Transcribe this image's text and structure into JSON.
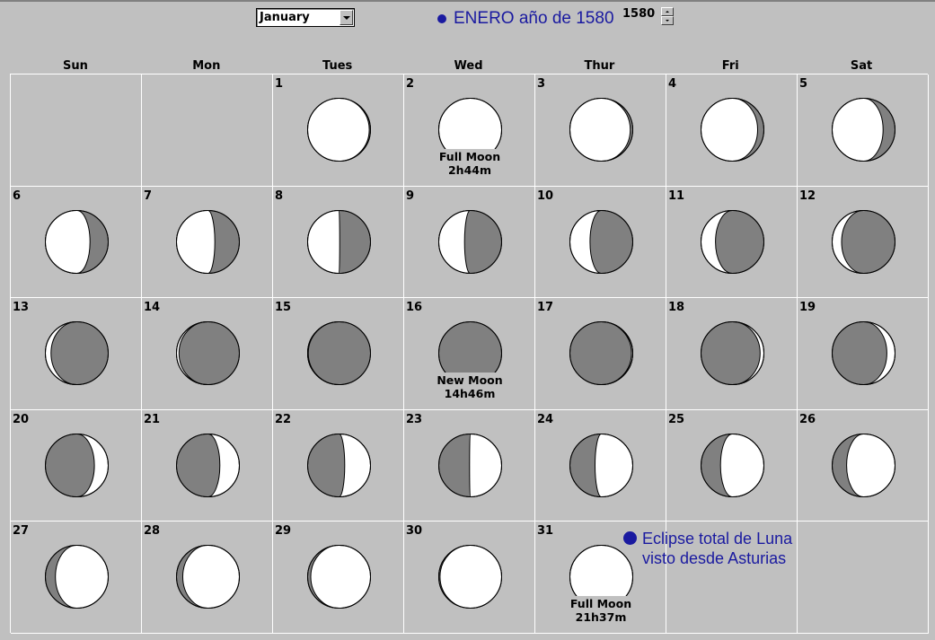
{
  "controls": {
    "month_selected": "January",
    "title": "ENERO año de 1580",
    "year": "1580"
  },
  "weekdays": [
    "Sun",
    "Mon",
    "Tues",
    "Wed",
    "Thur",
    "Fri",
    "Sat"
  ],
  "calendar": {
    "leading_blank_days": 2,
    "days": [
      {
        "day": "1",
        "illum": 0.98,
        "waxing": false
      },
      {
        "day": "2",
        "illum": 1.0,
        "waxing": false,
        "event": "Full Moon",
        "time": "2h44m"
      },
      {
        "day": "3",
        "illum": 0.96,
        "waxing": false
      },
      {
        "day": "4",
        "illum": 0.9,
        "waxing": false
      },
      {
        "day": "5",
        "illum": 0.81,
        "waxing": false
      },
      {
        "day": "6",
        "illum": 0.71,
        "waxing": false
      },
      {
        "day": "7",
        "illum": 0.61,
        "waxing": false
      },
      {
        "day": "8",
        "illum": 0.51,
        "waxing": false
      },
      {
        "day": "9",
        "illum": 0.41,
        "waxing": false
      },
      {
        "day": "10",
        "illum": 0.32,
        "waxing": false
      },
      {
        "day": "11",
        "illum": 0.23,
        "waxing": false
      },
      {
        "day": "12",
        "illum": 0.15,
        "waxing": false
      },
      {
        "day": "13",
        "illum": 0.09,
        "waxing": false
      },
      {
        "day": "14",
        "illum": 0.04,
        "waxing": false
      },
      {
        "day": "15",
        "illum": 0.01,
        "waxing": false
      },
      {
        "day": "16",
        "illum": 0.0,
        "waxing": true,
        "event": "New Moon",
        "time": "14h46m"
      },
      {
        "day": "17",
        "illum": 0.02,
        "waxing": true
      },
      {
        "day": "18",
        "illum": 0.06,
        "waxing": true
      },
      {
        "day": "19",
        "illum": 0.13,
        "waxing": true
      },
      {
        "day": "20",
        "illum": 0.22,
        "waxing": true
      },
      {
        "day": "21",
        "illum": 0.31,
        "waxing": true
      },
      {
        "day": "22",
        "illum": 0.41,
        "waxing": true
      },
      {
        "day": "23",
        "illum": 0.51,
        "waxing": true
      },
      {
        "day": "24",
        "illum": 0.6,
        "waxing": true
      },
      {
        "day": "25",
        "illum": 0.69,
        "waxing": true
      },
      {
        "day": "26",
        "illum": 0.77,
        "waxing": true
      },
      {
        "day": "27",
        "illum": 0.84,
        "waxing": true
      },
      {
        "day": "28",
        "illum": 0.9,
        "waxing": true
      },
      {
        "day": "29",
        "illum": 0.95,
        "waxing": true
      },
      {
        "day": "30",
        "illum": 0.98,
        "waxing": true
      },
      {
        "day": "31",
        "illum": 1.0,
        "waxing": true,
        "event": "Full Moon",
        "time": "21h37m"
      }
    ]
  },
  "annotation": {
    "line1": "Eclipse total de Luna",
    "line2": "visto desde Asturias"
  },
  "colors": {
    "background": "#c0c0c0",
    "moon_lit": "#ffffff",
    "moon_dark": "#808080",
    "accent_blue": "#1a1aa0"
  }
}
